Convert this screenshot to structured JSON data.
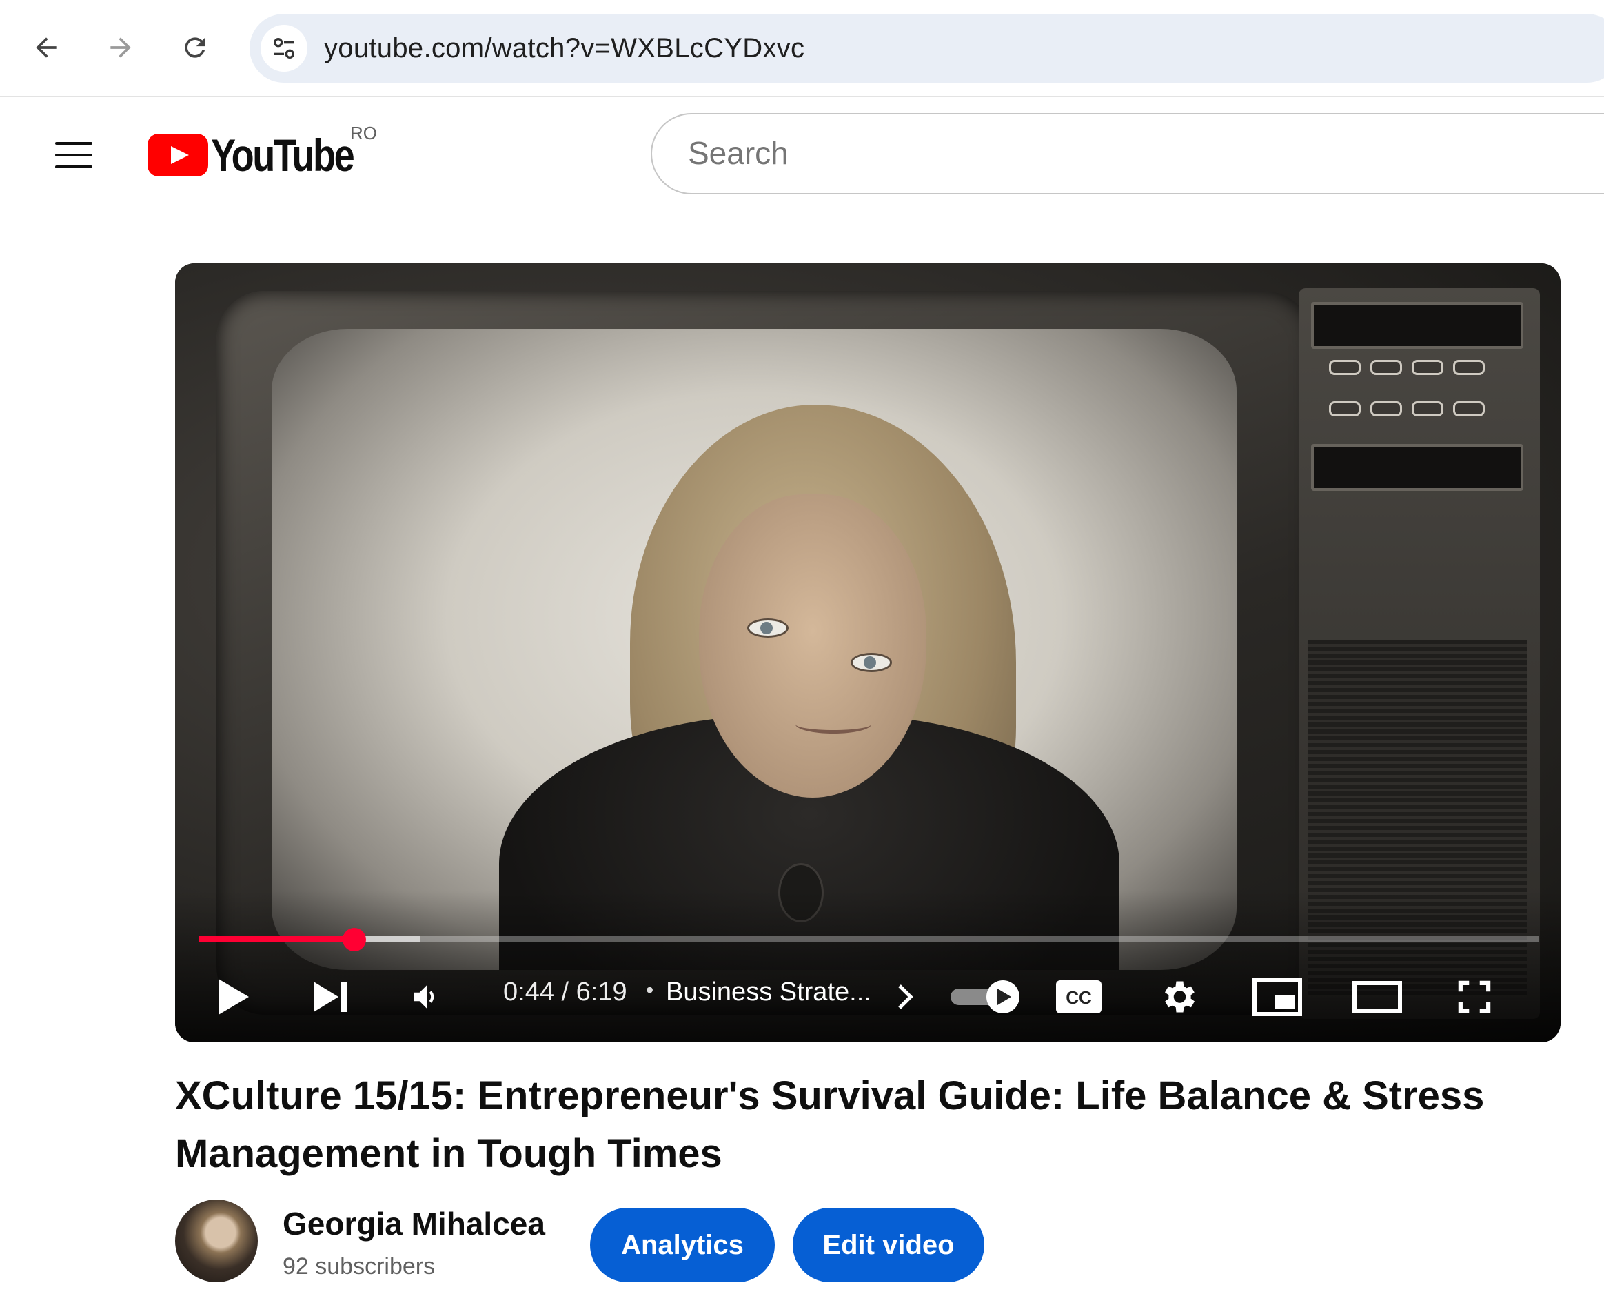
{
  "browser": {
    "url": "youtube.com/watch?v=WXBLcCYDxvc",
    "icons": {
      "back": "arrow-left-icon",
      "forward": "arrow-right-icon",
      "reload": "reload-icon",
      "site_info": "tune-icon"
    }
  },
  "header": {
    "logo_text": "YouTube",
    "country_code": "RO",
    "search_placeholder": "Search"
  },
  "player": {
    "current_time": "0:44",
    "duration": "6:19",
    "time_display": "0:44 / 6:19",
    "chapter_separator": "•",
    "chapter": "Business Strate...",
    "progress_fraction": 0.116,
    "buffer_fraction": 0.165,
    "accent_color": "#ff0033",
    "controls": [
      "play-icon",
      "next-icon",
      "volume-icon",
      "autoplay-toggle",
      "captions-icon",
      "settings-icon",
      "miniplayer-icon",
      "theater-icon",
      "fullscreen-icon"
    ]
  },
  "video": {
    "title": "XCulture 15/15: Entrepreneur's Survival Guide: Life Balance & Stress Management in Tough Times"
  },
  "channel": {
    "name": "Georgia Mihalcea",
    "subscribers": "92 subscribers"
  },
  "actions": {
    "analytics_label": "Analytics",
    "edit_label": "Edit video",
    "button_color": "#065fd4"
  }
}
